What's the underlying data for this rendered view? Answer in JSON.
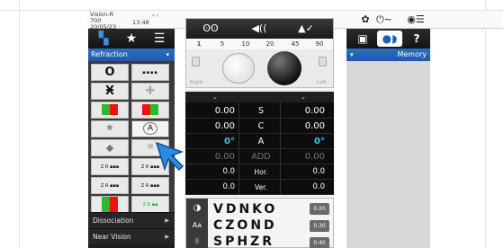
{
  "status": {
    "device": "Vision-R 700",
    "date": "20/05/23",
    "time": "13:48",
    "sub": "‹ ›"
  },
  "left_panel": {
    "tab_icons": [
      "grid-icon",
      "star-icon",
      "list-icon"
    ],
    "section_title": "Refraction",
    "menu_items": [
      {
        "label": "Dissociation"
      },
      {
        "label": "Near Vision"
      }
    ],
    "cursor_cell": "cross-cylinder-test"
  },
  "lens_panel": {
    "steps": [
      "1",
      "5",
      "10",
      "20",
      "45",
      "90"
    ],
    "active_step": "1",
    "right_label": "Right",
    "left_label": "Left"
  },
  "data_panel": {
    "rows": [
      {
        "left": "0.00",
        "label": "S",
        "right": "0.00",
        "style": ""
      },
      {
        "left": "0.00",
        "label": "C",
        "right": "0.00",
        "style": ""
      },
      {
        "left": "0°",
        "label": "A",
        "right": "0°",
        "style": "cyan"
      },
      {
        "left": "0.00",
        "label": "ADD",
        "right": "0.00",
        "style": "dim"
      },
      {
        "left": "0.0",
        "label": "Hor.",
        "right": "0.0",
        "style": "small"
      },
      {
        "left": "0.0",
        "label": "Ver.",
        "right": "0.0",
        "style": "small"
      }
    ]
  },
  "chart_panel": {
    "rows": [
      {
        "letters": "VDNKO",
        "acuity": "0.20"
      },
      {
        "letters": "CZOND",
        "acuity": "0.30"
      },
      {
        "letters": "SPHZR",
        "acuity": "0.40"
      }
    ]
  },
  "right_panel": {
    "section_title": "Memory",
    "help_label": "?"
  },
  "colors": {
    "accent": "#2d6fc0",
    "cyan": "#3fc3f3",
    "panel_dark": "#0d0d0d"
  }
}
